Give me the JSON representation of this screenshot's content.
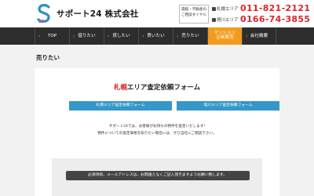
{
  "header": {
    "logo_text": "サポート24 株式会社",
    "contact_note_1": "貸越・不動産の",
    "contact_note_2": "ご相談ダイヤル",
    "phones": [
      {
        "area": "札幌エリア",
        "number": "011-821-2121"
      },
      {
        "area": "旭川エリア",
        "number": "0166-74-3855"
      }
    ]
  },
  "nav": {
    "items": [
      {
        "label": "TOP"
      },
      {
        "label": "借りたい"
      },
      {
        "label": "貸したい"
      },
      {
        "label": "買いたい"
      },
      {
        "label": "売りたい"
      },
      {
        "label_1": "マンション",
        "label_2": "企画販売"
      },
      {
        "label": "会社概要"
      }
    ]
  },
  "page": {
    "title": "売りたい"
  },
  "form": {
    "title_accent": "札幌",
    "title_rest": "エリア査定依頼フォーム",
    "tab_left": "札幌エリア査定依頼フォーム",
    "tab_right": "旭川エリア査定依頼フォーム",
    "intro_1": "サポート24では、お客様がお持ちの物件を査定いたします!",
    "intro_2": "物件についての査定価格を知りたい場合には、ぜひ当社にご相談下さい。",
    "notice": "必須項目、メールアドレスは、お間違えなくご記入頂きますようお願い致します。"
  },
  "colors": {
    "accent_red": "#d9262c",
    "nav_bg": "#2d2d2d",
    "nav_active": "#f29b1d",
    "tab_blue": "#3598c8"
  }
}
